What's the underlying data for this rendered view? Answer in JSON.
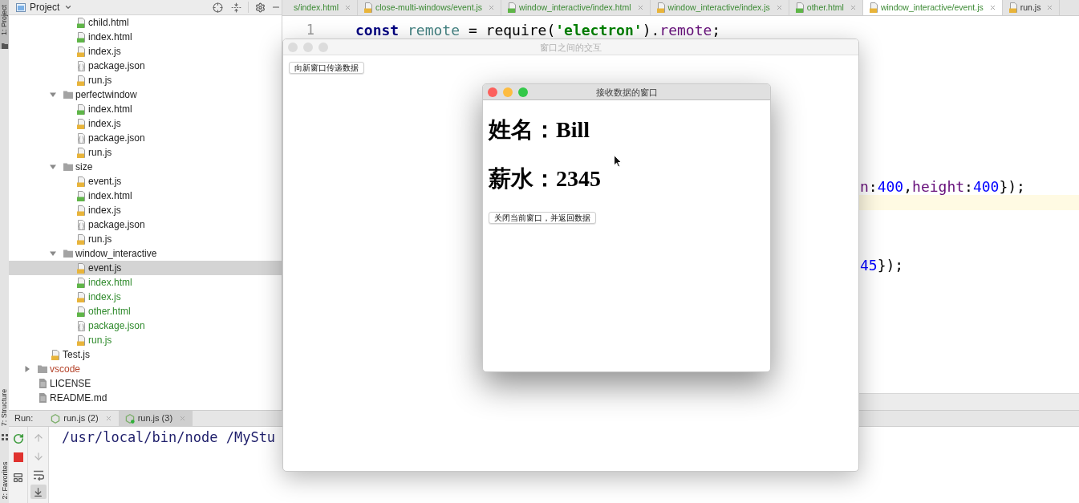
{
  "tool_strip": [
    {
      "label": "1: Project",
      "selected": true
    },
    {
      "label": "7: Structure",
      "selected": false
    },
    {
      "label": "2: Favorites",
      "selected": false
    }
  ],
  "project_panel": {
    "title": "Project",
    "tree": [
      {
        "children": [
          {
            "children": [
              {
                "children": [
                  {
                    "name": "child.html",
                    "kind": "html",
                    "selected": false
                  },
                  {
                    "name": "index.html",
                    "kind": "html",
                    "selected": false
                  },
                  {
                    "name": "index.js",
                    "kind": "js",
                    "selected": false
                  },
                  {
                    "name": "package.json",
                    "kind": "json",
                    "selected": false
                  },
                  {
                    "name": "run.js",
                    "kind": "js",
                    "selected": false
                  }
                ]
              },
              {
                "name": "perfectwindow",
                "kind": "folder",
                "expanded": true,
                "selected": false,
                "children": [
                  {
                    "name": "index.html",
                    "kind": "html",
                    "selected": false
                  },
                  {
                    "name": "index.js",
                    "kind": "js",
                    "selected": false
                  },
                  {
                    "name": "package.json",
                    "kind": "json",
                    "selected": false
                  },
                  {
                    "name": "run.js",
                    "kind": "js",
                    "selected": false
                  }
                ]
              },
              {
                "name": "size",
                "kind": "folder",
                "expanded": true,
                "selected": false,
                "children": [
                  {
                    "name": "event.js",
                    "kind": "js",
                    "selected": false
                  },
                  {
                    "name": "index.html",
                    "kind": "html",
                    "selected": false
                  },
                  {
                    "name": "index.js",
                    "kind": "js",
                    "selected": false
                  },
                  {
                    "name": "package.json",
                    "kind": "json",
                    "selected": false
                  },
                  {
                    "name": "run.js",
                    "kind": "js",
                    "selected": false
                  }
                ]
              },
              {
                "name": "window_interactive",
                "kind": "folder",
                "expanded": true,
                "selected": false,
                "children": [
                  {
                    "name": "event.js",
                    "kind": "js",
                    "selected": true
                  },
                  {
                    "name": "index.html",
                    "kind": "html",
                    "selected": false,
                    "color": "#2f8a2c"
                  },
                  {
                    "name": "index.js",
                    "kind": "js",
                    "selected": false,
                    "color": "#2f8a2c"
                  },
                  {
                    "name": "other.html",
                    "kind": "html",
                    "selected": false,
                    "color": "#2f8a2c"
                  },
                  {
                    "name": "package.json",
                    "kind": "json",
                    "selected": false,
                    "color": "#2f8a2c"
                  },
                  {
                    "name": "run.js",
                    "kind": "js",
                    "selected": false,
                    "color": "#2f8a2c"
                  }
                ]
              }
            ]
          },
          {
            "name": "Test.js",
            "kind": "js",
            "selected": false
          }
        ]
      },
      {
        "name": "vscode",
        "kind": "folder",
        "expanded": false,
        "selected": false,
        "color": "#b5452c"
      },
      {
        "name": "LICENSE",
        "kind": "text",
        "selected": false
      },
      {
        "name": "README.md",
        "kind": "text",
        "selected": false
      }
    ]
  },
  "editor": {
    "tabs": [
      {
        "label": "s/index.html",
        "selected": false,
        "color": "#3c8a34"
      },
      {
        "label": "close-multi-windows/event.js",
        "kind": "js",
        "selected": false,
        "color": "#3c8a34"
      },
      {
        "label": "window_interactive/index.html",
        "kind": "html",
        "selected": false,
        "color": "#3c8a34"
      },
      {
        "label": "window_interactive/index.js",
        "kind": "js",
        "selected": false,
        "color": "#3c8a34"
      },
      {
        "label": "other.html",
        "kind": "html",
        "selected": false,
        "color": "#3c8a34"
      },
      {
        "label": "window_interactive/event.js",
        "kind": "js",
        "selected": true,
        "color": "#3c8a34"
      },
      {
        "label": "run.js",
        "kind": "js",
        "selected": false,
        "color": "#333333"
      }
    ],
    "lines": [
      {
        "number": "1",
        "current": false,
        "tokens": [
          {
            "text": "const",
            "kind": "keyword"
          },
          {
            "text": " remote",
            "kind": "variable"
          },
          {
            "text": " = require(",
            "kind": "plain"
          },
          {
            "text": "'electron'",
            "kind": "string"
          },
          {
            "text": ").",
            "kind": "plain"
          },
          {
            "text": "remote",
            "kind": "property"
          },
          {
            "text": ";",
            "kind": "plain"
          }
        ]
      },
      {
        "current": false
      },
      {
        "current": false
      },
      {
        "current": false
      },
      {
        "current": false
      },
      {
        "current": false
      },
      {
        "current": false
      },
      {
        "current": false
      },
      {
        "current": false
      },
      {
        "current": false
      },
      {
        "current": false,
        "tokens": [
          {
            "text": "n",
            "kind": "property"
          },
          {
            "text": ":",
            "kind": "plain"
          },
          {
            "text": "400",
            "kind": "number"
          },
          {
            "text": ",",
            "kind": "plain"
          },
          {
            "text": "height",
            "kind": "property"
          },
          {
            "text": ":",
            "kind": "plain"
          },
          {
            "text": "400",
            "kind": "number"
          },
          {
            "text": "});",
            "kind": "plain"
          }
        ]
      },
      {
        "current": true
      },
      {
        "current": false
      },
      {
        "current": false
      },
      {
        "current": false
      },
      {
        "current": false,
        "tokens": [
          {
            "text": "45",
            "kind": "number"
          },
          {
            "text": "});",
            "kind": "plain"
          }
        ]
      }
    ]
  },
  "run_panel": {
    "title": "Run:",
    "tabs": [
      {
        "label": "run.js (2)",
        "selected": false,
        "running": false
      },
      {
        "label": "run.js (3)",
        "selected": true,
        "running": true
      }
    ],
    "console": "/usr/local/bin/node /MyStu"
  },
  "windows": [
    {
      "title": "窗口之间的交互",
      "active": false,
      "content": [
        {
          "kind": "button",
          "text": "向新窗口传递数据"
        }
      ]
    },
    {
      "title": "接收数据的窗口",
      "active": true,
      "content": [
        {
          "kind": "heading",
          "text": "姓名：Bill"
        },
        {
          "kind": "heading",
          "text": "薪水：2345"
        },
        {
          "kind": "button",
          "text": "关闭当前窗口，并返回数据"
        }
      ]
    }
  ]
}
